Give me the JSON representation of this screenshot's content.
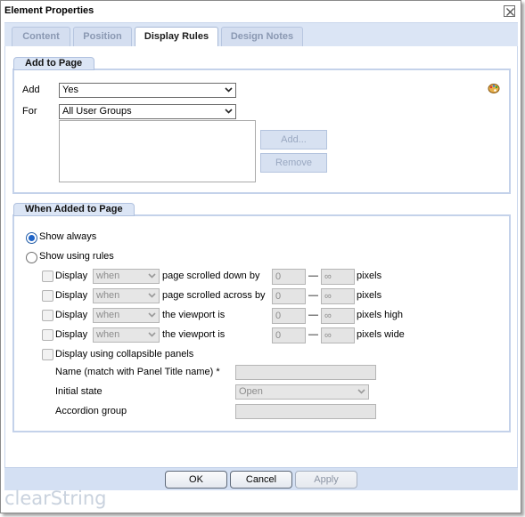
{
  "dialog": {
    "title": "Element Properties",
    "close_icon": "close-icon"
  },
  "tabs": [
    {
      "label": "Content",
      "active": false
    },
    {
      "label": "Position",
      "active": false
    },
    {
      "label": "Display Rules",
      "active": true
    },
    {
      "label": "Design Notes",
      "active": false
    }
  ],
  "add_to_page": {
    "legend": "Add to Page",
    "add_label": "Add",
    "add_value": "Yes",
    "for_label": "For",
    "for_value": "All User Groups",
    "add_button": "Add...",
    "remove_button": "Remove",
    "palette_icon": "palette-icon"
  },
  "when_added": {
    "legend": "When Added to Page",
    "show_always": "Show always",
    "show_using_rules": "Show using rules",
    "rules": [
      {
        "label": "Display",
        "condition": "when",
        "description": "page scrolled down by",
        "from": "0",
        "to": "∞",
        "unit": "pixels"
      },
      {
        "label": "Display",
        "condition": "when",
        "description": "page scrolled across by",
        "from": "0",
        "to": "∞",
        "unit": "pixels"
      },
      {
        "label": "Display",
        "condition": "when",
        "description": "the viewport is",
        "from": "0",
        "to": "∞",
        "unit": "pixels high"
      },
      {
        "label": "Display",
        "condition": "when",
        "description": "the viewport is",
        "from": "0",
        "to": "∞",
        "unit": "pixels wide"
      }
    ],
    "dash": "—",
    "collapsible": "Display using collapsible panels",
    "name_label": "Name (match with Panel Title name) *",
    "initial_state_label": "Initial state",
    "initial_state_value": "Open",
    "accordion_label": "Accordion group"
  },
  "footer": {
    "ok": "OK",
    "cancel": "Cancel",
    "apply": "Apply"
  },
  "brand": "clearString",
  "colors": {
    "accent": "#1f64c8",
    "panel_bg": "#dbe5f5",
    "footer_bg": "#d4e0f3"
  }
}
